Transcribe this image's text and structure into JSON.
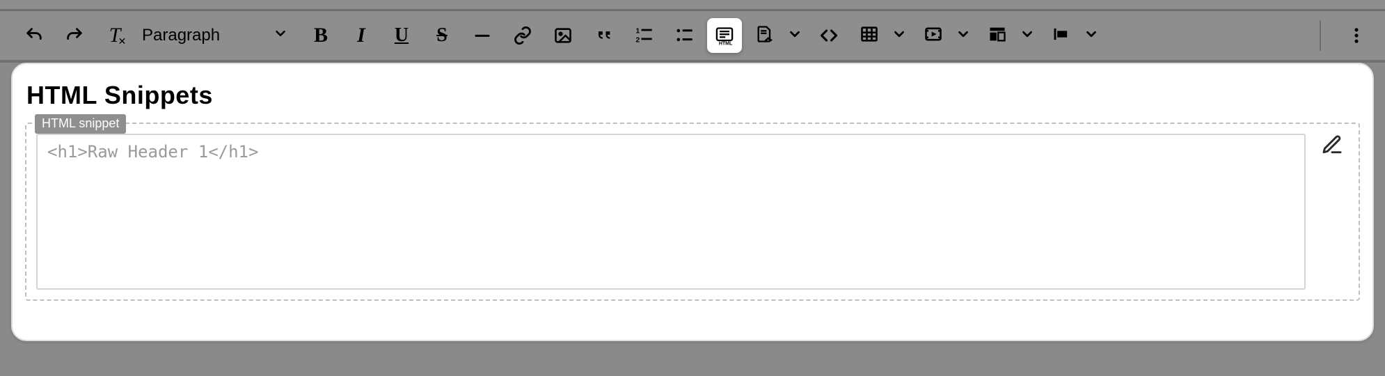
{
  "toolbar": {
    "block_style": "Paragraph"
  },
  "content": {
    "title": "HTML Snippets",
    "chip": "HTML snippet",
    "code": "<h1>Raw Header 1</h1>"
  },
  "icons": {
    "undo": "undo",
    "redo": "redo",
    "clear_format": "clear-format",
    "bold": "B",
    "italic": "I",
    "underline": "U",
    "strike": "S",
    "hr": "hr",
    "link": "link",
    "image": "image",
    "quote": "quote",
    "ol": "ordered-list",
    "ul": "unordered-list",
    "html_snippet": "html-snippet",
    "template": "template",
    "code": "code-view",
    "table": "table",
    "media": "media",
    "layout": "layout",
    "align": "align",
    "more": "more"
  }
}
